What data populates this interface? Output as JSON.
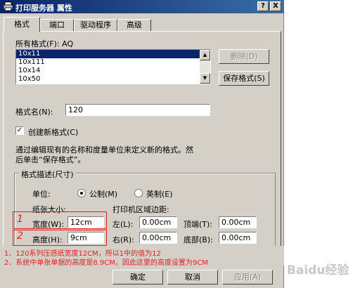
{
  "window": {
    "title": "打印服务器 属性",
    "help_label": "?",
    "close_label": "X"
  },
  "tabs": [
    {
      "label": "格式"
    },
    {
      "label": "端口"
    },
    {
      "label": "驱动程序"
    },
    {
      "label": "高级"
    }
  ],
  "forms_section": {
    "label": "所有格式(F): AQ",
    "items": [
      "10x11",
      "10x111",
      "10x14",
      "10x50"
    ],
    "selected_index": 0,
    "delete_button": "删除(D)",
    "save_button": "保存格式(S)"
  },
  "form_name": {
    "label": "格式名(N):",
    "value": "120"
  },
  "create_new": {
    "label": "创建新格式(C)",
    "checked": true,
    "check_glyph": "✓"
  },
  "description": {
    "line1": "通过编辑现有的名称和度量单位来定义新的格式。然",
    "line2": "后单击“保存格式”。"
  },
  "form_description": {
    "group_title": "格式描述(尺寸)",
    "unit_label": "单位:",
    "metric_label": "公制(M)",
    "english_label": "英制(E)",
    "paper_size_label": "纸张大小:",
    "width_label": "宽度(W):",
    "width_value": "12cm",
    "height_label": "高度(H):",
    "height_value": "9cm",
    "margins_label": "打印机区域边距:",
    "left_label": "左(L):",
    "left_value": "0.00cm",
    "top_label": "顶端(T):",
    "top_value": "0.00cm",
    "right_label": "右(R):",
    "right_value": "0.00cm",
    "bottom_label": "底部(B):",
    "bottom_value": "0.00cm"
  },
  "annotations": {
    "mark1": "1",
    "mark2": "2",
    "note1": "1、120系列压感纸宽度12CM，所以1中的值为12",
    "note2": "2、系统中单张单据的高度是8.9CM，因此这里的高度设置为9CM"
  },
  "footer": {
    "ok_button": "确定",
    "cancel_button": "取消",
    "apply_button": "应用(A)"
  },
  "watermark": {
    "text": "Baidu经验"
  }
}
